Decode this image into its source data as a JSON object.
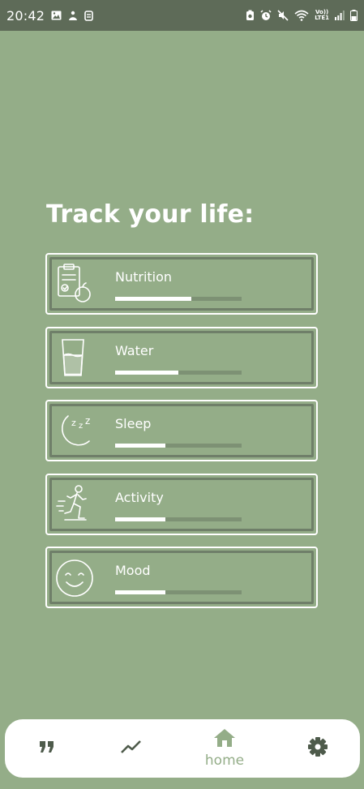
{
  "status_bar": {
    "time": "20:42",
    "network": "LTE1",
    "volte": "Vo))"
  },
  "title": "Track your life:",
  "trackers": [
    {
      "label": "Nutrition",
      "icon": "clipboard-apple-icon",
      "progress": 0.6
    },
    {
      "label": "Water",
      "icon": "glass-icon",
      "progress": 0.5
    },
    {
      "label": "Sleep",
      "icon": "moon-zzz-icon",
      "progress": 0.4
    },
    {
      "label": "Activity",
      "icon": "running-person-icon",
      "progress": 0.4
    },
    {
      "label": "Mood",
      "icon": "smiley-icon",
      "progress": 0.4
    }
  ],
  "nav": {
    "home_label": "home",
    "items": [
      "quote-icon",
      "trend-icon",
      "home-icon",
      "settings-icon"
    ],
    "active": "home"
  },
  "colors": {
    "background": "#94ad88",
    "status_bar": "#5e6b58",
    "card_inner_border": "#6f7f69",
    "bar_track": "#7d9174",
    "nav_accent": "#94ad88",
    "nav_icon": "#4e5b4b"
  }
}
